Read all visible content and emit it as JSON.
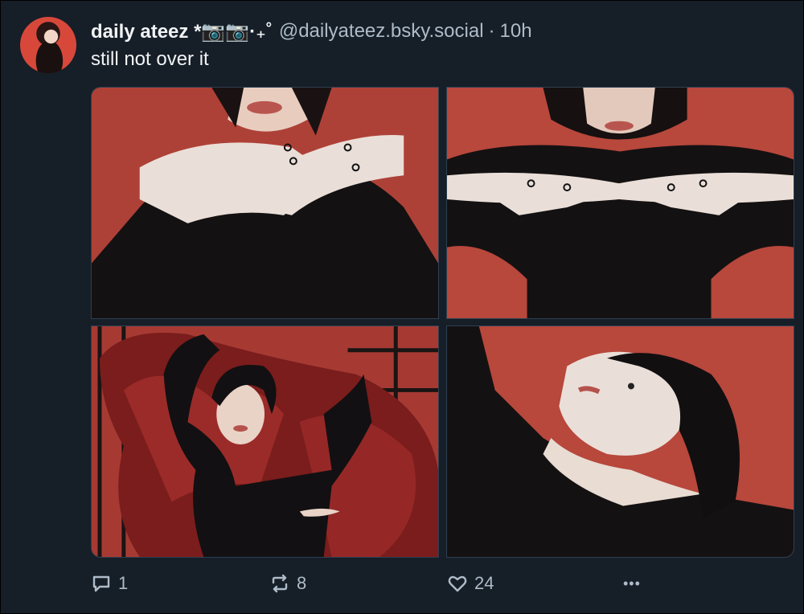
{
  "post": {
    "display_name": "daily ateez *📷📷·₊˚",
    "handle": "@dailyateez.bsky.social",
    "separator": "·",
    "time": "10h",
    "text": "still not over it"
  },
  "images": [
    {
      "label": "photo-1",
      "subject": "hands with rings in front of face"
    },
    {
      "label": "photo-2",
      "subject": "hands crossed at chest"
    },
    {
      "label": "photo-3",
      "subject": "reclining on red satin"
    },
    {
      "label": "photo-4",
      "subject": "head tilted back profile"
    }
  ],
  "actions": {
    "reply_count": "1",
    "repost_count": "8",
    "like_count": "24",
    "more_label": "•••"
  },
  "icons": {
    "reply": "speech-bubble-icon",
    "repost": "repost-arrows-icon",
    "like": "heart-icon",
    "more": "ellipsis-icon"
  },
  "colors": {
    "background": "#161e27",
    "text": "#f1f3f5",
    "muted": "#aebbc9",
    "photo_red": "#b8473c"
  }
}
